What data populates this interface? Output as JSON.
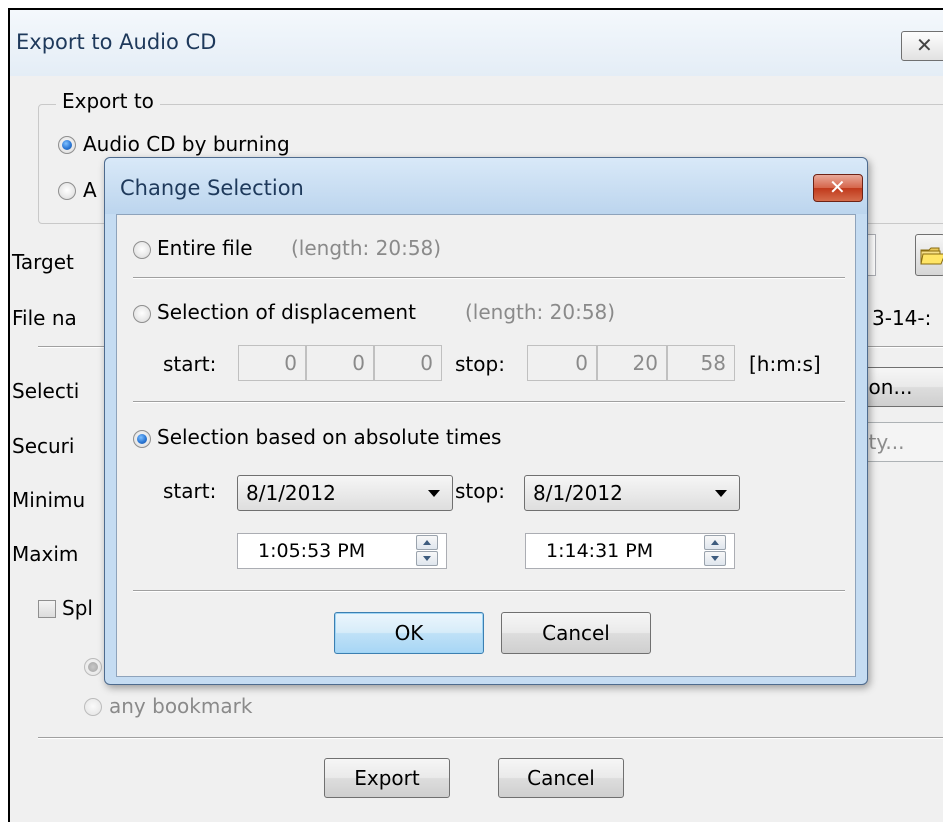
{
  "back_dialog": {
    "title": "Export to Audio CD",
    "close_glyph": "✕",
    "export_to": {
      "legend": "Export to",
      "options": [
        {
          "label": "Audio CD by burning",
          "selected": true
        },
        {
          "label": "A",
          "selected": false
        }
      ]
    },
    "labels": {
      "target": "Target",
      "file_name": "File na",
      "file_name_value_tail": "3-14-:",
      "selection": "Selecti",
      "security": "Securi",
      "minimum": "Minimu",
      "maximum": "Maxim",
      "split": "Spl"
    },
    "selection_button_tail": "ion...",
    "security_button_tail": "ity...",
    "any_bookmark": "any bookmark",
    "buttons": {
      "export": "Export",
      "cancel": "Cancel"
    }
  },
  "change_selection": {
    "title": "Change Selection",
    "close_glyph": "✕",
    "entire_file": {
      "label": "Entire file",
      "length": "(length: 20:58)",
      "selected": false
    },
    "displacement": {
      "label": "Selection of displacement",
      "length": "(length: 20:58)",
      "selected": false,
      "start_label": "start:",
      "stop_label": "stop:",
      "start": {
        "h": "0",
        "m": "0",
        "s": "0"
      },
      "stop": {
        "h": "0",
        "m": "20",
        "s": "58"
      },
      "unit": "[h:m:s]"
    },
    "absolute": {
      "label": "Selection based on absolute times",
      "selected": true,
      "start_label": "start:",
      "stop_label": "stop:",
      "start_date": "8/1/2012",
      "stop_date": "8/1/2012",
      "start_time": "1:05:53 PM",
      "stop_time": "1:14:31 PM"
    },
    "buttons": {
      "ok": "OK",
      "cancel": "Cancel"
    }
  },
  "colors": {
    "accent": "#3c7fb1",
    "titlebar": "#c5dcf2",
    "close_red": "#c0391b"
  }
}
